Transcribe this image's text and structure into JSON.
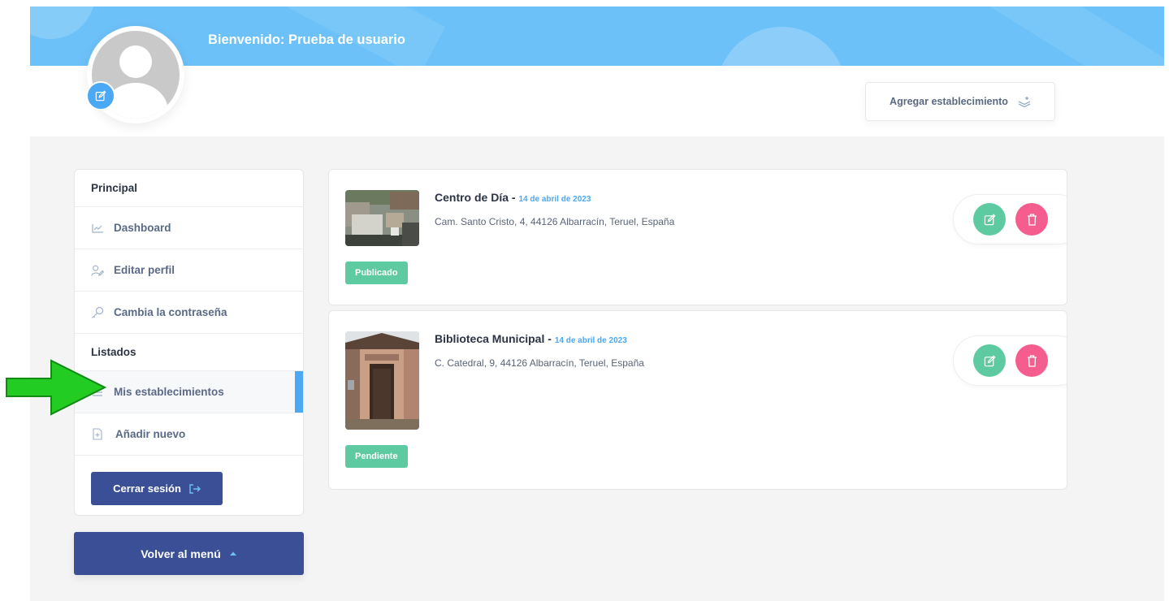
{
  "header": {
    "welcome": "Bienvenido: Prueba de usuario",
    "add_button_label": "Agregar establecimiento"
  },
  "sidebar": {
    "sections": [
      {
        "title": "Principal",
        "items": [
          {
            "label": "Dashboard",
            "icon": "chart-icon"
          },
          {
            "label": "Editar perfil",
            "icon": "user-edit-icon"
          },
          {
            "label": "Cambia la contraseña",
            "icon": "key-icon"
          }
        ]
      },
      {
        "title": "Listados",
        "items": [
          {
            "label": "Mis establecimientos",
            "icon": "list-icon",
            "active": true
          },
          {
            "label": "Añadir nuevo",
            "icon": "file-plus-icon"
          }
        ]
      }
    ],
    "logout_label": "Cerrar sesión",
    "back_menu_label": "Volver al menú"
  },
  "listings": [
    {
      "title": "Centro de Día",
      "separator": " - ",
      "date": "14 de abril de 2023",
      "address": "Cam. Santo Cristo, 4, 44126 Albarracín, Teruel, España",
      "status": "Publicado"
    },
    {
      "title": "Biblioteca Municipal",
      "separator": " - ",
      "date": "14 de abril de 2023",
      "address": "C. Catedral, 9, 44126 Albarracín, Teruel, España",
      "status": "Pendiente"
    }
  ],
  "colors": {
    "banner": "#6cc1f8",
    "accent": "#4aa8f5",
    "navy": "#3a4f95",
    "status_green": "#5ecaa2",
    "delete_pink": "#f55d8f",
    "annotation_arrow": "#22cc22"
  }
}
